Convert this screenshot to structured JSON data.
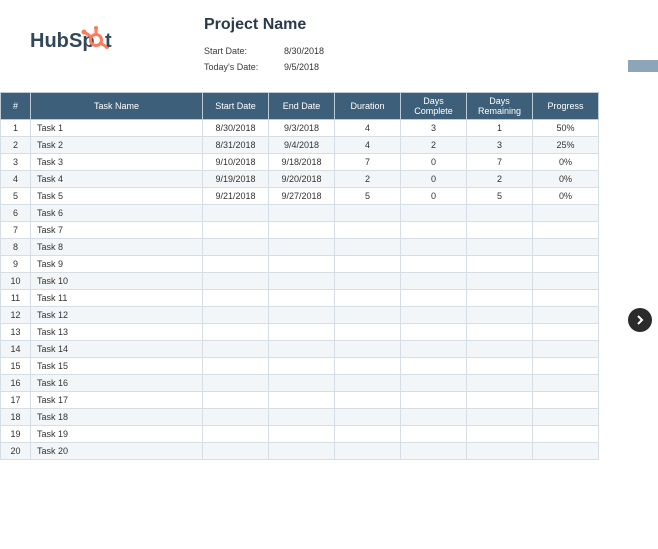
{
  "logo": {
    "text_hub": "Hub",
    "text_spot_left": "Sp",
    "text_spot_right": "t"
  },
  "project": {
    "title": "Project Name",
    "start_label": "Start Date:",
    "start_value": "8/30/2018",
    "today_label": "Today's Date:",
    "today_value": "9/5/2018"
  },
  "columns": {
    "idx": "#",
    "task": "Task Name",
    "start": "Start Date",
    "end": "End Date",
    "dur": "Duration",
    "dc": "Days Complete",
    "dr": "Days Remaining",
    "pr": "Progress"
  },
  "rows": [
    {
      "idx": "1",
      "task": "Task 1",
      "start": "8/30/2018",
      "end": "9/3/2018",
      "dur": "4",
      "dc": "3",
      "dr": "1",
      "pr": "50%"
    },
    {
      "idx": "2",
      "task": "Task 2",
      "start": "8/31/2018",
      "end": "9/4/2018",
      "dur": "4",
      "dc": "2",
      "dr": "3",
      "pr": "25%"
    },
    {
      "idx": "3",
      "task": "Task 3",
      "start": "9/10/2018",
      "end": "9/18/2018",
      "dur": "7",
      "dc": "0",
      "dr": "7",
      "pr": "0%"
    },
    {
      "idx": "4",
      "task": "Task 4",
      "start": "9/19/2018",
      "end": "9/20/2018",
      "dur": "2",
      "dc": "0",
      "dr": "2",
      "pr": "0%"
    },
    {
      "idx": "5",
      "task": "Task 5",
      "start": "9/21/2018",
      "end": "9/27/2018",
      "dur": "5",
      "dc": "0",
      "dr": "5",
      "pr": "0%"
    },
    {
      "idx": "6",
      "task": "Task 6",
      "start": "",
      "end": "",
      "dur": "",
      "dc": "",
      "dr": "",
      "pr": ""
    },
    {
      "idx": "7",
      "task": "Task 7",
      "start": "",
      "end": "",
      "dur": "",
      "dc": "",
      "dr": "",
      "pr": ""
    },
    {
      "idx": "8",
      "task": "Task 8",
      "start": "",
      "end": "",
      "dur": "",
      "dc": "",
      "dr": "",
      "pr": ""
    },
    {
      "idx": "9",
      "task": "Task 9",
      "start": "",
      "end": "",
      "dur": "",
      "dc": "",
      "dr": "",
      "pr": ""
    },
    {
      "idx": "10",
      "task": "Task 10",
      "start": "",
      "end": "",
      "dur": "",
      "dc": "",
      "dr": "",
      "pr": ""
    },
    {
      "idx": "11",
      "task": "Task 11",
      "start": "",
      "end": "",
      "dur": "",
      "dc": "",
      "dr": "",
      "pr": ""
    },
    {
      "idx": "12",
      "task": "Task 12",
      "start": "",
      "end": "",
      "dur": "",
      "dc": "",
      "dr": "",
      "pr": ""
    },
    {
      "idx": "13",
      "task": "Task 13",
      "start": "",
      "end": "",
      "dur": "",
      "dc": "",
      "dr": "",
      "pr": ""
    },
    {
      "idx": "14",
      "task": "Task 14",
      "start": "",
      "end": "",
      "dur": "",
      "dc": "",
      "dr": "",
      "pr": ""
    },
    {
      "idx": "15",
      "task": "Task 15",
      "start": "",
      "end": "",
      "dur": "",
      "dc": "",
      "dr": "",
      "pr": ""
    },
    {
      "idx": "16",
      "task": "Task 16",
      "start": "",
      "end": "",
      "dur": "",
      "dc": "",
      "dr": "",
      "pr": ""
    },
    {
      "idx": "17",
      "task": "Task 17",
      "start": "",
      "end": "",
      "dur": "",
      "dc": "",
      "dr": "",
      "pr": ""
    },
    {
      "idx": "18",
      "task": "Task 18",
      "start": "",
      "end": "",
      "dur": "",
      "dc": "",
      "dr": "",
      "pr": ""
    },
    {
      "idx": "19",
      "task": "Task 19",
      "start": "",
      "end": "",
      "dur": "",
      "dc": "",
      "dr": "",
      "pr": ""
    },
    {
      "idx": "20",
      "task": "Task 20",
      "start": "",
      "end": "",
      "dur": "",
      "dc": "",
      "dr": "",
      "pr": ""
    }
  ]
}
